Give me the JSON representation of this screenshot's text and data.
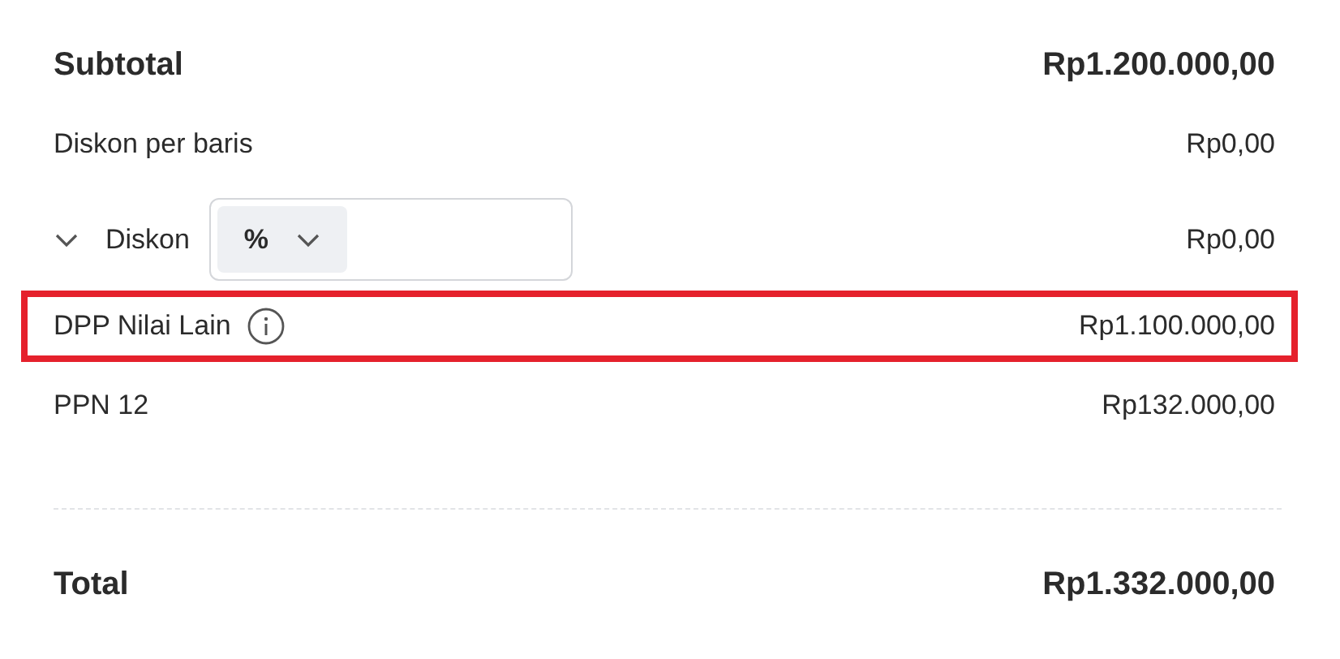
{
  "rows": [
    {
      "kind": "subtotal",
      "label": "Subtotal",
      "amount": "Rp1.200.000,00",
      "highlighted": false
    },
    {
      "kind": "plain",
      "label": "Diskon per baris",
      "amount": "Rp0,00",
      "highlighted": false
    },
    {
      "kind": "discount",
      "label": "Diskon",
      "expanded": false,
      "unit": "%",
      "amount": "Rp0,00",
      "highlighted": false
    },
    {
      "kind": "info",
      "label": "DPP Nilai Lain",
      "amount": "Rp1.100.000,00",
      "highlighted": true
    },
    {
      "kind": "plain",
      "label": "PPN 12",
      "amount": "Rp132.000,00",
      "highlighted": false
    },
    {
      "kind": "divider"
    },
    {
      "kind": "total",
      "label": "Total",
      "amount": "Rp1.332.000,00",
      "highlighted": false
    }
  ]
}
